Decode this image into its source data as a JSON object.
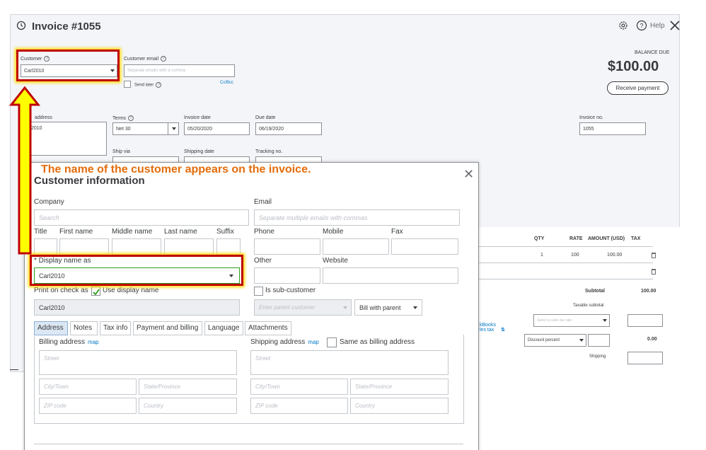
{
  "invoice": {
    "title": "Invoice #1055",
    "help_label": "Help",
    "customer_label": "Customer",
    "customer_value": "Carl2010",
    "email_label": "Customer email",
    "email_placeholder": "Separate emails with a comma",
    "send_later_label": "Send later",
    "cc_bcc_label": "Cc/Bcc",
    "balance_due_label": "BALANCE DUE",
    "balance_due_amount": "$100.00",
    "receive_payment_label": "Receive payment",
    "billing_address_label": "address",
    "billing_address_value": "2010",
    "terms_label": "Terms",
    "terms_value": "Net 30",
    "invoice_date_label": "Invoice date",
    "invoice_date_value": "05/20/2020",
    "due_date_label": "Due date",
    "due_date_value": "06/19/2020",
    "invoice_no_label": "Invoice no.",
    "invoice_no_value": "1055",
    "ship_via_label": "Ship via",
    "shipping_date_label": "Shipping date",
    "tracking_no_label": "Tracking no.",
    "table": {
      "headers": [
        "QTY",
        "RATE",
        "AMOUNT (USD)",
        "TAX"
      ],
      "row1": {
        "qty": "1",
        "rate": "100",
        "amount": "100.00"
      }
    },
    "subtotal_label": "Subtotal",
    "subtotal_value": "100.00",
    "taxable_subtotal_label": "Taxable subtotal",
    "sales_tax_placeholder": "Select a sales tax rate",
    "qb_label_1": "kBooks",
    "qb_label_2": "les tax",
    "discount_label": "Discount percent",
    "discount_value": "0.00",
    "shipping_label": "Shipping"
  },
  "modal": {
    "title": "Customer information",
    "company_label": "Company",
    "company_placeholder": "Search",
    "email_label": "Email",
    "email_placeholder": "Separate multiple emails with commas",
    "title_label": "Title",
    "first_name_label": "First name",
    "middle_name_label": "Middle name",
    "last_name_label": "Last name",
    "suffix_label": "Suffix",
    "phone_label": "Phone",
    "mobile_label": "Mobile",
    "fax_label": "Fax",
    "display_name_label": "* Display name as",
    "display_name_value": "Carl2010",
    "other_label": "Other",
    "website_label": "Website",
    "print_on_check_label": "Print on check as",
    "use_display_name_label": "Use display name",
    "print_on_check_value": "Carl2010",
    "sub_customer_label": "Is sub-customer",
    "parent_customer_placeholder": "Enter parent customer",
    "bill_with_parent_label": "Bill with parent",
    "tabs": [
      "Address",
      "Notes",
      "Tax info",
      "Payment and billing",
      "Language",
      "Attachments"
    ],
    "billing_address_label": "Billing address",
    "shipping_address_label": "Shipping address",
    "map_label": "map",
    "same_as_billing_label": "Same as billing address",
    "street_placeholder": "Street",
    "city_placeholder": "City/Town",
    "state_placeholder": "State/Province",
    "zip_placeholder": "ZIP code",
    "country_placeholder": "Country"
  },
  "annotation": {
    "text": "The name of the customer appears on the invoice.",
    "highlight_color": "#c00000",
    "glow_color": "#ffd700",
    "text_color": "#e46c0a"
  }
}
